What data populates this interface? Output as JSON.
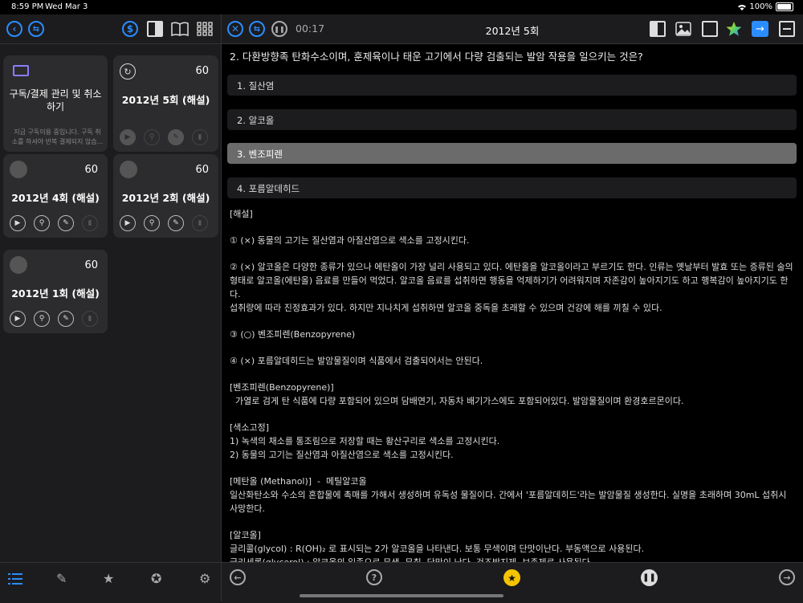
{
  "status": {
    "time": "8:59 PM",
    "date": "Wed Mar 3",
    "battery": "100%"
  },
  "left": {
    "subscription": {
      "label_line1": "구독/결제 관리 및 취소",
      "label_line2": "하기",
      "desc_line1": "지금 구독이용 중입니다. 구독 취",
      "desc_line2": "소를 하셔야 반복 결제되지 않습..."
    },
    "cards": [
      {
        "title": "2012년 5회 (해설)",
        "count": "60"
      },
      {
        "title": "2012년 4회 (해설)",
        "count": "60"
      },
      {
        "title": "2012년 2회 (해설)",
        "count": "60"
      },
      {
        "title": "2012년 1회 (해설)",
        "count": "60"
      }
    ]
  },
  "right": {
    "title": "2012년 5회",
    "timer": "00:17",
    "question": "2. 다환방향족 탄화수소이며, 훈제육이나 태운 고기에서 다량 검출되는 발암 작용을 일으키는 것은?",
    "options": [
      "1. 질산염",
      "2. 알코올",
      "3. 벤조피렌",
      "4. 포름알데히드"
    ],
    "selected_option_index": 2,
    "explanation": {
      "heading": "[해설]",
      "p1": "① (×) 동물의 고기는 질산염과 아질산염으로 색소를 고정시킨다.",
      "p2_l1": "② (×) 알코올은 다양한 종류가 있으나 에탄올이 가장 널리 사용되고 있다. 에탄올을 알코올이라고 부르기도 한다. 인류는 옛날부터 발효 또는 증류된 술의",
      "p2_l2": "형태로 알코올(에탄올) 음료를 만들어 먹었다. 알코올 음료를 섭취하면 행동을 억제하기가 어려워지며 자존감이 높아지기도 하고 행복감이 높아지기도 한다.",
      "p2_l3": "섭취량에 따라 진정효과가 있다. 하지만 지나치게 섭취하면 알코올 중독을 초래할 수 있으며 건강에 해를 끼칠 수 있다.",
      "p3": "③ (○) 벤조피렌(Benzopyrene)",
      "p4": "④ (×) 포름알데히드는 발암물질이며 식품에서 검출되어서는 안된다.",
      "b1_title": "[벤조피렌(Benzopyrene)]",
      "b1_text": "  가열로 검게 탄 식품에 다량 포함되어 있으며 담배연기, 자동차 배기가스에도 포함되어있다. 발암물질이며 환경호르몬이다.",
      "b2_title": "[색소고정]",
      "b2_l1": "1) 녹색의 채소를 통조림으로 저장할 때는 황산구리로 색소를 고정시킨다.",
      "b2_l2": "2) 동물의 고기는 질산염과 아질산염으로 색소를 고정시킨다.",
      "b3_title": "[메탄올 (Methanol)]  -  메틸알코올",
      "b3_l1": " 일산화탄소와 수소의 혼합물에 촉매를 가해서 생성하며 유독성 물질이다. 간에서 '포름알데히드'라는 발암물질 생성한다. 실명을 초래하며 30mL 섭취시",
      "b3_l2": "사망한다.",
      "b4_title": "[알코올]",
      "b4_l1": "글리콜(glycol) : R(OH)₂ 로 표시되는 2가 알코올을 나타낸다. 보통 무색이며 단맛이난다. 부동액으로 사용된다.",
      "b4_l2": "글리세롤(glycerol) : 알코올의 일종으로 무색, 무취, 단맛이 난다. 건조방지제, 보존제로 사용된다."
    }
  },
  "colors": {
    "accent": "#2b8cff",
    "star": "#f5c400",
    "selected_option": "#6b6b6b"
  }
}
